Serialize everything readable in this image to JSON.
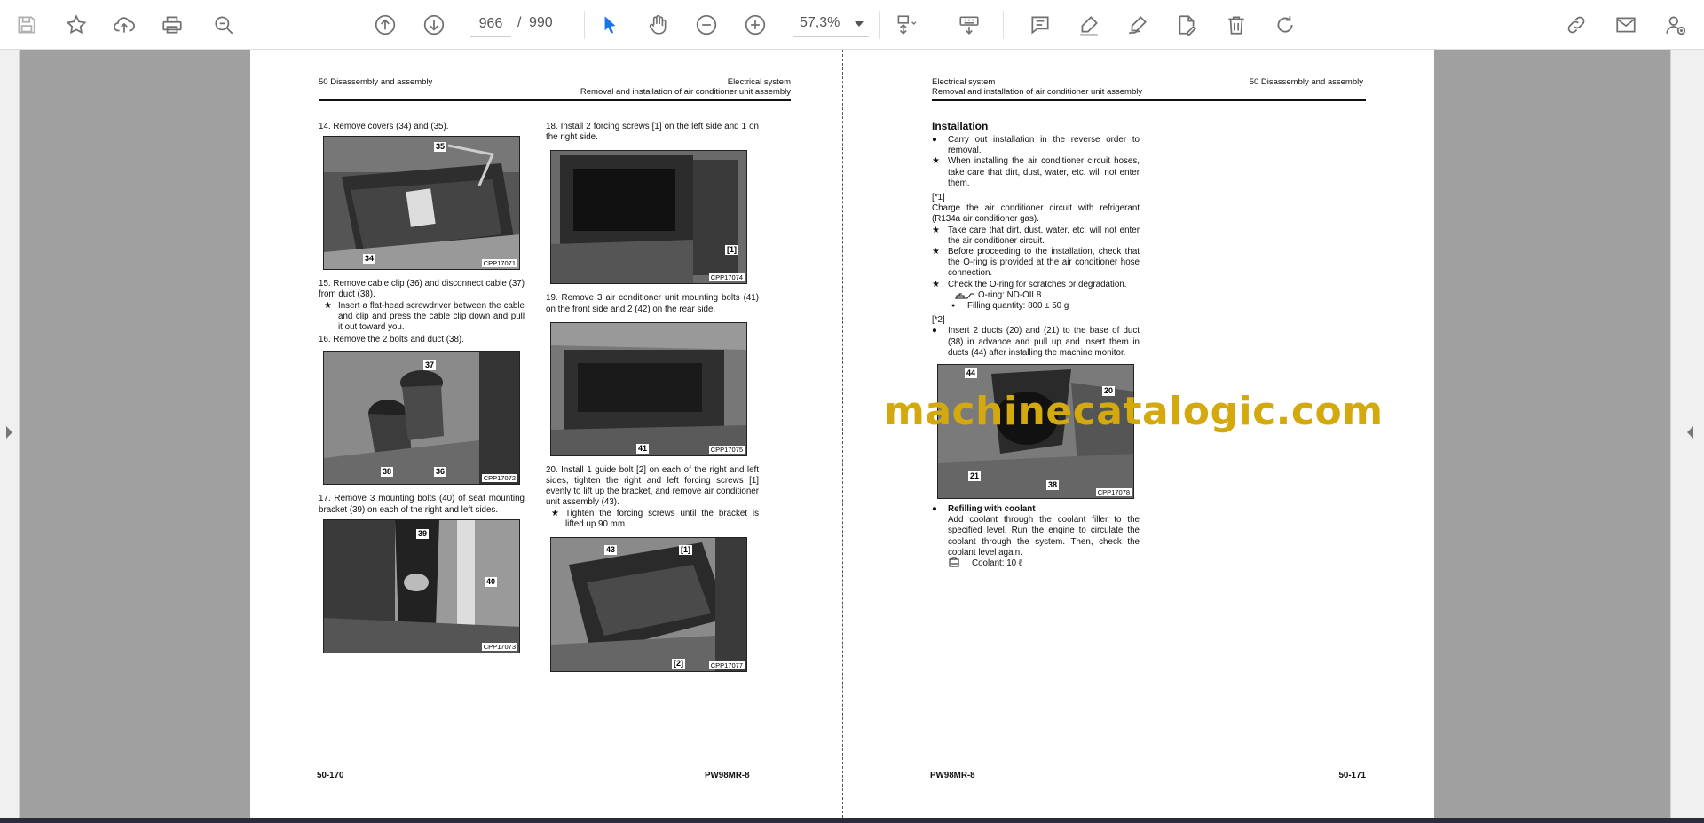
{
  "toolbar": {
    "page_current": "966",
    "page_separator": "/",
    "page_total": "990",
    "zoom": "57,3%"
  },
  "left_page": {
    "header_left": "50 Disassembly and assembly",
    "header_right_1": "Electrical system",
    "header_right_2": "Removal and installation of air conditioner unit assembly",
    "footer_left": "50-170",
    "footer_right": "PW98MR-8",
    "steps": {
      "s14": "14. Remove covers (34) and (35).",
      "s15": "15. Remove cable clip (36) and disconnect cable (37) from duct (38).",
      "s15_note": "Insert a flat-head screwdriver between the cable and clip and press the cable clip down and pull it out toward you.",
      "s16": "16. Remove the 2 bolts and duct (38).",
      "s17": "17. Remove 3 mounting bolts (40) of seat mounting bracket (39) on each of the right and left sides.",
      "s18": "18. Install 2 forcing screws [1] on the left side and 1 on the right side.",
      "s19": "19. Remove 3 air conditioner unit mounting bolts (41) on the front side and 2 (42) on the rear side.",
      "s20": "20. Install 1 guide bolt [2] on each of the right and left sides, tighten the right and left forcing screws [1] evenly to lift up the bracket, and remove air conditioner unit assembly (43).",
      "s20_note": "Tighten the forcing screws until the bracket is lifted up 90 mm."
    },
    "photos": {
      "p1": {
        "code": "CPP17071",
        "callouts": [
          "35",
          "34"
        ]
      },
      "p2": {
        "code": "CPP17072",
        "callouts": [
          "37",
          "38",
          "36"
        ]
      },
      "p3": {
        "code": "CPP17073",
        "callouts": [
          "39",
          "40"
        ]
      },
      "p4": {
        "code": "CPP17074",
        "callouts": [
          "[1]"
        ]
      },
      "p5": {
        "code": "CPP17075",
        "callouts": [
          "41"
        ]
      },
      "p6": {
        "code": "CPP17077",
        "callouts": [
          "43",
          "[1]",
          "[2]"
        ]
      }
    }
  },
  "right_page": {
    "header_left_1": "Electrical system",
    "header_left_2": "Removal and installation of air conditioner unit assembly",
    "header_right": "50 Disassembly and assembly",
    "footer_left": "PW98MR-8",
    "footer_right": "50-171",
    "title": "Installation",
    "b1": "Carry out installation in the reverse order to removal.",
    "b2": "When installing the air conditioner circuit hoses, take care that dirt, dust, water, etc. will not enter them.",
    "ref1": "[*1]",
    "charge": "Charge the air conditioner circuit with refrigerant (R134a air conditioner gas).",
    "b3": "Take care that dirt, dust, water, etc. will not enter the air conditioner circuit.",
    "b4": "Before proceeding to the installation, check that the O-ring is provided at the air conditioner hose connection.",
    "b5": "Check the O-ring for scratches or degradation.",
    "oring": "O-ring: ND-OIL8",
    "filling": "Filling quantity: 800 ± 50 g",
    "ref2": "[*2]",
    "b6": "Insert 2 ducts (20) and (21) to the base of duct (38) in advance and pull up and insert them in ducts (44) after installing the machine monitor.",
    "photo": {
      "code": "CPP17078",
      "callouts": [
        "44",
        "20",
        "21",
        "38"
      ]
    },
    "refill_title": "Refilling with coolant",
    "refill_text": "Add coolant through the coolant filler to the specified level. Run the engine to circulate the coolant through the system. Then, check the coolant level again.",
    "coolant": "Coolant: 10 ℓ"
  },
  "markers": {
    "bullet": "●",
    "star": "★",
    "dot": "●"
  },
  "watermark": "machinecatalogic.com",
  "colors": {
    "watermark": "#d4a90d",
    "toolbar_icon": "#707070",
    "select_tool": "#1a73e8",
    "viewer_bg": "#a0a0a0"
  }
}
